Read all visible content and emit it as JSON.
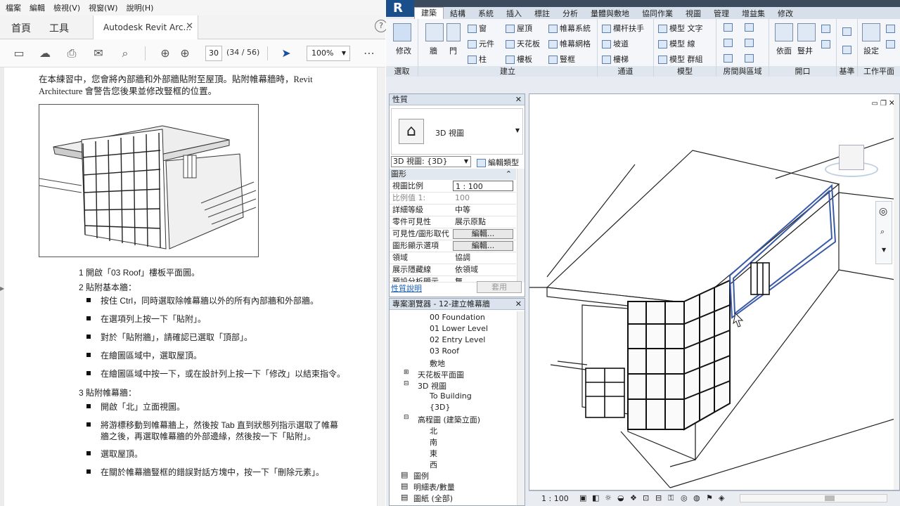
{
  "pdf": {
    "menu": [
      "檔案",
      "編輯",
      "檢視(V)",
      "視窗(W)",
      "說明(H)"
    ],
    "nav_tabs": [
      "首頁",
      "工具"
    ],
    "doc_tab": "Autodesk Revit Arc...",
    "page_current": "30",
    "page_total": "(34 / 56)",
    "zoom": "100%",
    "intro_line1": "在本練習中，您會將內部牆和外部牆貼附至屋頂。貼附帷幕牆時，Revit",
    "intro_line2": "Architecture 會警告您後果並修改豎框的位置。",
    "steps": [
      {
        "label": "1 開啟「03 Roof」樓板平面圖。"
      },
      {
        "label": "2 貼附基本牆："
      },
      {
        "label": "3 貼附帷幕牆："
      }
    ],
    "bullets_step2": [
      "按住 Ctrl，同時選取除帷幕牆以外的所有內部牆和外部牆。",
      "在選項列上按一下「貼附」。",
      "對於「貼附牆」，請確認已選取「頂部」。",
      "在繪圖區域中，選取屋頂。",
      "在繪圖區域中按一下，或在設計列上按一下「修改」以結束指令。"
    ],
    "bullets_step3": [
      "開啟「北」立面視圖。",
      "將游標移動到帷幕牆上，然後按 Tab 直到狀態列指示選取了帷幕",
      "牆之後，再選取帷幕牆的外部邊緣，然後按一下「貼附」。",
      "選取屋頂。",
      "在關於帷幕牆豎框的錯誤對話方塊中，按一下「刪除元素」。"
    ]
  },
  "revit": {
    "logo": "R",
    "tabs": [
      "建築",
      "結構",
      "系統",
      "插入",
      "標註",
      "分析",
      "量體與敷地",
      "協同作業",
      "視圖",
      "管理",
      "增益集",
      "修改"
    ],
    "ribbon": {
      "select_label": "選取",
      "modify": "修改",
      "build_label": "建立",
      "build_items": [
        "牆",
        "門",
        "窗",
        "元件",
        "柱",
        "屋頂",
        "天花板",
        "樓板",
        "帷幕系統",
        "帷幕網格",
        "豎框"
      ],
      "circulation_label": "通道",
      "circulation_items": [
        "欄杆扶手",
        "坡道",
        "樓梯"
      ],
      "model_label": "模型",
      "model_items": [
        "模型 文字",
        "模型 線",
        "模型 群組"
      ],
      "room_label": "房間與區域",
      "opening_label": "開口",
      "opening_items": [
        "依面",
        "豎井"
      ],
      "datum_label": "基準",
      "workplane_label": "工作平面",
      "set": "設定"
    },
    "properties": {
      "title": "性質",
      "type": "3D 視圖",
      "view_selector": "3D 視圖: {3D}",
      "edit_type": "編輯類型",
      "section": "圖形",
      "rows": [
        {
          "k": "視圖比例",
          "v": "1 : 100"
        },
        {
          "k": "比例值 1:",
          "v": "100"
        },
        {
          "k": "詳細等級",
          "v": "中等"
        },
        {
          "k": "零件可見性",
          "v": "展示原點"
        },
        {
          "k": "可見性/圖形取代",
          "v": "編輯..."
        },
        {
          "k": "圖形顯示選項",
          "v": "編輯..."
        },
        {
          "k": "領域",
          "v": "協調"
        },
        {
          "k": "展示隱藏線",
          "v": "依領域"
        },
        {
          "k": "預設分析顯示...",
          "v": "無"
        }
      ],
      "help": "性質說明",
      "apply": "套用"
    },
    "browser": {
      "title": "專案瀏覽器 - 12-建立帷幕牆",
      "levels": [
        "00 Foundation",
        "01 Lower Level",
        "02 Entry Level",
        "03 Roof",
        "敷地"
      ],
      "ceiling": "天花板平面圖",
      "view3d": "3D 視圖",
      "views3d": [
        "To Building",
        "{3D}"
      ],
      "elevations": "高程圖 (建築立面)",
      "elev_items": [
        "北",
        "南",
        "東",
        "西"
      ],
      "legend": "圖例",
      "schedules": "明細表/數量",
      "sheets": "圖紙 (全部)"
    },
    "status_scale": "1 : 100"
  }
}
